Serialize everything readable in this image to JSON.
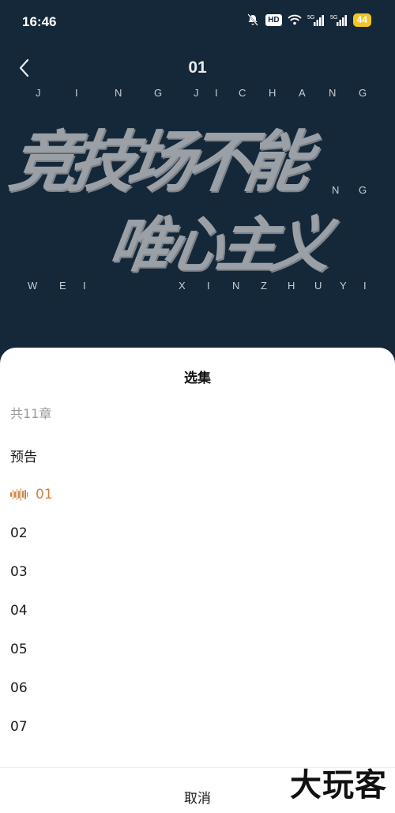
{
  "status_bar": {
    "time": "16:46",
    "hd": "HD",
    "net1": "5G",
    "net2": "5G",
    "battery": "44"
  },
  "header": {
    "title": "01"
  },
  "cover": {
    "pinyin_top": [
      "J",
      "I",
      "N",
      "G",
      "J",
      "I",
      "C",
      "H",
      "A",
      "N",
      "G"
    ],
    "pinyin_mid": [
      "N",
      "G"
    ],
    "pinyin_bottom": [
      "W",
      "E",
      "I",
      "X",
      "I",
      "N",
      "Z",
      "H",
      "U",
      "Y",
      "I"
    ],
    "calligraphy_line1": "竞技场不能",
    "calligraphy_line2": "唯心主义"
  },
  "sheet": {
    "title": "选集",
    "count": "共11章",
    "items": [
      {
        "label": "预告",
        "active": false
      },
      {
        "label": "01",
        "active": true
      },
      {
        "label": "02",
        "active": false
      },
      {
        "label": "03",
        "active": false
      },
      {
        "label": "04",
        "active": false
      },
      {
        "label": "05",
        "active": false
      },
      {
        "label": "06",
        "active": false
      },
      {
        "label": "07",
        "active": false
      }
    ],
    "cancel_label": "取消"
  },
  "watermark": "大玩客",
  "colors": {
    "accent": "#c9843f",
    "background": "#15283a"
  },
  "icons": {
    "back": "chevron-left-icon",
    "playing": "sound-wave-icon"
  }
}
